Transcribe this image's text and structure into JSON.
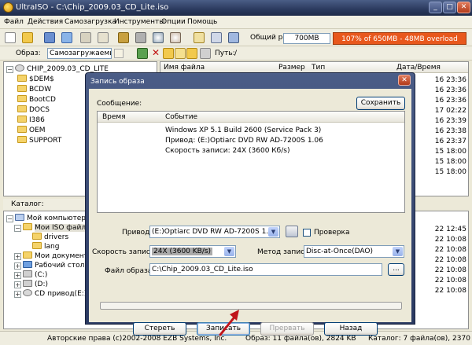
{
  "app": {
    "title": "UltraISO - C:\\Chip_2009.03_CD_Lite.iso",
    "buttons": {
      "minimize": "_",
      "maximize": "□",
      "close": "✕"
    }
  },
  "menu": [
    "Файл",
    "Действия",
    "Самозагрузка",
    "Инструменты",
    "Опции",
    "Помощь"
  ],
  "toolbar": {
    "total_size_label": "Общий размер:",
    "total_size_value": "700MB",
    "overload_text": "107% of 650MB - 48MB overload"
  },
  "toolbar2": {
    "image_label": "Образ:",
    "image_type": "Самозагружаемый",
    "path_label": "Путь:",
    "path_value": "/"
  },
  "iso_tree": {
    "root": "CHIP_2009.03_CD_LITE",
    "items": [
      "$DEM$",
      "BCDW",
      "BootCD",
      "DOCS",
      "I386",
      "OEM",
      "SUPPORT"
    ]
  },
  "file_list": {
    "columns": [
      "Имя файла",
      "Размер",
      "Тип",
      "Дата/Время"
    ],
    "dates_top": [
      "16 23:36",
      "16 23:36",
      "16 23:36",
      "17 02:22",
      "16 23:39",
      "16 23:38",
      "16 23:37",
      "15 18:00",
      "15 18:00",
      "15 18:00"
    ],
    "dates_bottom": [
      "22 12:45",
      "22 10:08",
      "22 10:08",
      "22 10:08",
      "22 10:08",
      "22 10:08",
      "22 10:08"
    ]
  },
  "catalog": {
    "label": "Каталог:",
    "items": [
      "Мой компьютер",
      "Мои ISO файлы",
      "drivers",
      "lang",
      "Мои документы",
      "Рабочий стол",
      "(C:)",
      "(D:)",
      "CD привод(E:)"
    ]
  },
  "status": {
    "copyright": "Авторские права (c)2002-2008 EZB Systems, Inc.",
    "image_info": "Образ: 11 файла(ов), 2824 KB",
    "catalog_info": "Каталог: 7 файла(ов), 2370 KB"
  },
  "dialog": {
    "title": "Запись образа",
    "close": "✕",
    "message_label": "Сообщение:",
    "save_button": "Сохранить",
    "log_columns": [
      "Время",
      "Событие"
    ],
    "log_rows": [
      "Windows XP 5.1 Build 2600 (Service Pack 3)",
      "Привод: (E:)Optiarc DVD RW AD-7200S 1.06",
      "Скорость записи: 24X (3600 Кб/s)"
    ],
    "drive_label": "Привод:",
    "drive_value": "(E:)Optiarc DVD RW AD-7200S 1.06",
    "verify_label": "Проверка",
    "speed_label": "Скорость записи:",
    "speed_value": "24X (3600 KB/s)",
    "method_label": "Метод записи:",
    "method_value": "Disc-at-Once(DAO)",
    "image_file_label": "Файл образа:",
    "image_file_value": "C:\\Chip_2009.03_CD_Lite.iso",
    "browse": "...",
    "buttons": {
      "erase": "Стереть",
      "burn": "Записать",
      "abort": "Прервать",
      "back": "Назад"
    }
  },
  "colors": {
    "overload": "#e8571c",
    "titlebar": "#2b3a5e",
    "arrow": "#c0141a"
  }
}
